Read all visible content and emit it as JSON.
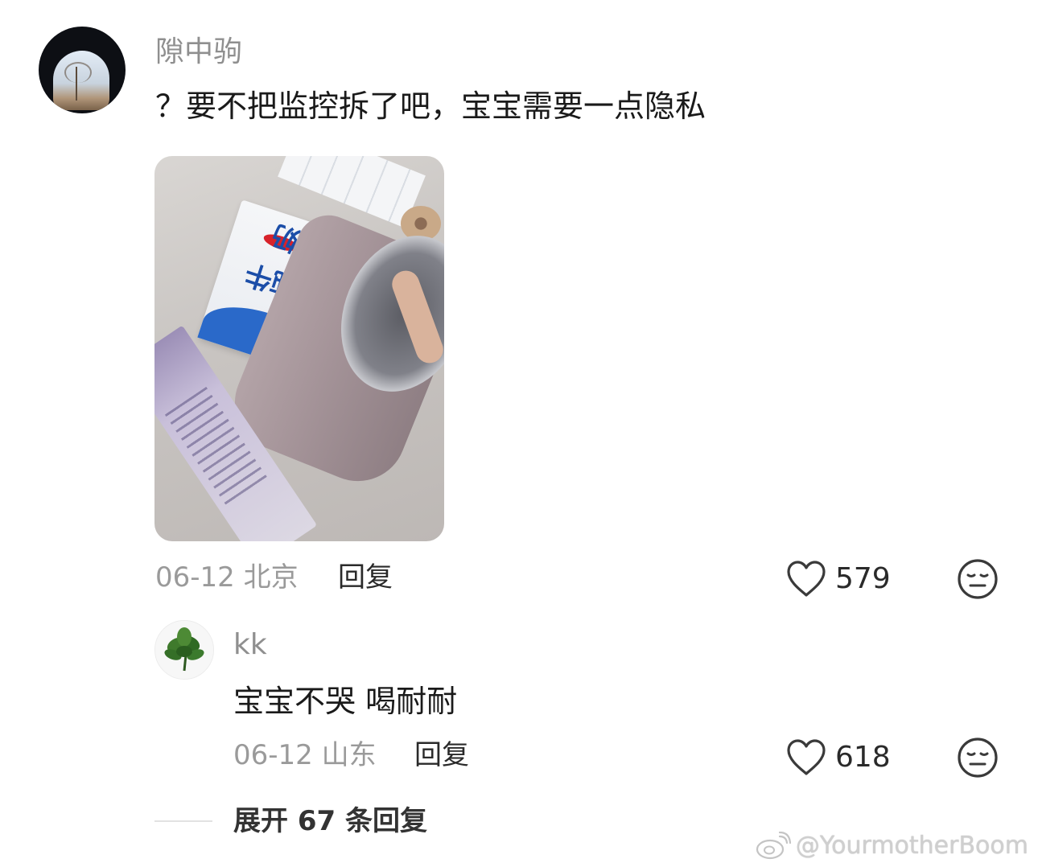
{
  "comment": {
    "username": "隙中驹",
    "text": "？要不把监控拆了吧，宝宝需要一点隐私",
    "meta": "06-12 北京",
    "reply_label": "回复",
    "likes": "579"
  },
  "sub_reply": {
    "username": "kk",
    "text": "宝宝不哭 喝耐耐",
    "meta": "06-12 山东",
    "reply_label": "回复",
    "likes": "618"
  },
  "expand": {
    "label": "展开 67 条回复"
  },
  "photo": {
    "box_label": "纯牛奶"
  },
  "watermark": {
    "text": "@YourmotherBoom"
  },
  "icons": {
    "like": "heart-outline-icon",
    "reaction": "neutral-face-icon",
    "weibo": "weibo-logo-icon"
  }
}
